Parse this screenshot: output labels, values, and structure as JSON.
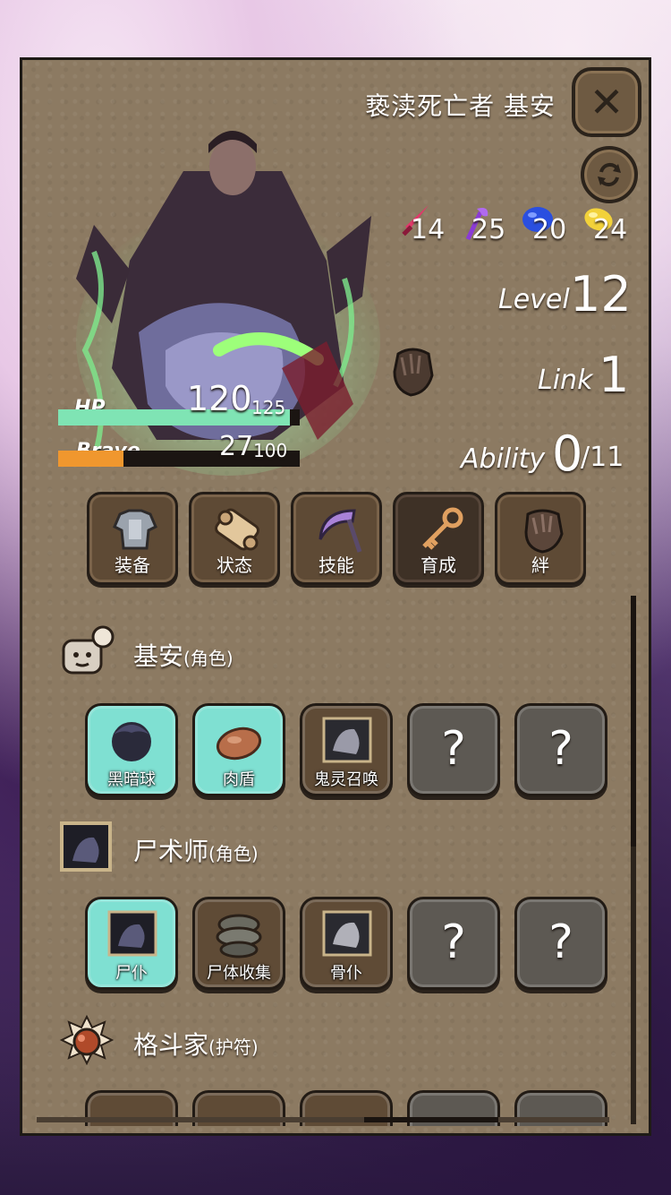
{
  "header": {
    "character_name": "亵渎死亡者 基安"
  },
  "gems": [
    {
      "icon": "red-sword-icon",
      "value": "14",
      "color": "#e0386a"
    },
    {
      "icon": "purple-staff-icon",
      "value": "25",
      "color": "#8b3ad6"
    },
    {
      "icon": "blue-gem-icon",
      "value": "20",
      "color": "#2a4fe0"
    },
    {
      "icon": "yellow-gem-icon",
      "value": "24",
      "color": "#f2d23a"
    }
  ],
  "stats": {
    "level_label": "Level",
    "level": "12",
    "link_label": "Link",
    "link": "1",
    "ability_label": "Ability",
    "ability": "0",
    "ability_max": "/11"
  },
  "bars": {
    "hp_label": "HP",
    "hp": "120",
    "hp_max": "125",
    "hp_fraction": 0.96,
    "brave_label": "Brave",
    "brave": "27",
    "brave_max": "100",
    "brave_fraction": 0.27
  },
  "tabs": [
    {
      "label": "装备",
      "icon": "armor-icon"
    },
    {
      "label": "状态",
      "icon": "scroll-icon"
    },
    {
      "label": "技能",
      "icon": "scythe-icon"
    },
    {
      "label": "育成",
      "icon": "key-icon",
      "active": true
    },
    {
      "label": "絆",
      "icon": "gauntlet-icon"
    }
  ],
  "sections": [
    {
      "title": "基安",
      "tag": "(角色)",
      "icon": "chat-face-icon",
      "slots": [
        {
          "label": "黑暗球",
          "style": "teal",
          "icon": "dark-orb-icon"
        },
        {
          "label": "肉盾",
          "style": "teal",
          "icon": "meat-icon"
        },
        {
          "label": "鬼灵召唤",
          "style": "brown",
          "icon": "ghost-portrait-icon"
        },
        {
          "label": "?",
          "style": "gray",
          "locked": true
        },
        {
          "label": "?",
          "style": "gray",
          "locked": true
        }
      ]
    },
    {
      "title": "尸术师",
      "tag": "(角色)",
      "icon": "necromancer-portrait-icon",
      "slots": [
        {
          "label": "尸仆",
          "style": "teal",
          "icon": "servant-portrait-icon"
        },
        {
          "label": "尸体收集",
          "style": "brown",
          "icon": "corpse-pile-icon"
        },
        {
          "label": "骨仆",
          "style": "brown",
          "icon": "bone-servant-icon"
        },
        {
          "label": "?",
          "style": "gray",
          "locked": true
        },
        {
          "label": "?",
          "style": "gray",
          "locked": true
        }
      ]
    },
    {
      "title": "格斗家",
      "tag": "(护符)",
      "icon": "fighter-amulet-icon",
      "slots": [
        {
          "label": "",
          "style": "brown"
        },
        {
          "label": "",
          "style": "brown"
        },
        {
          "label": "",
          "style": "brown"
        },
        {
          "label": "",
          "style": "gray"
        },
        {
          "label": "",
          "style": "gray"
        }
      ]
    }
  ]
}
